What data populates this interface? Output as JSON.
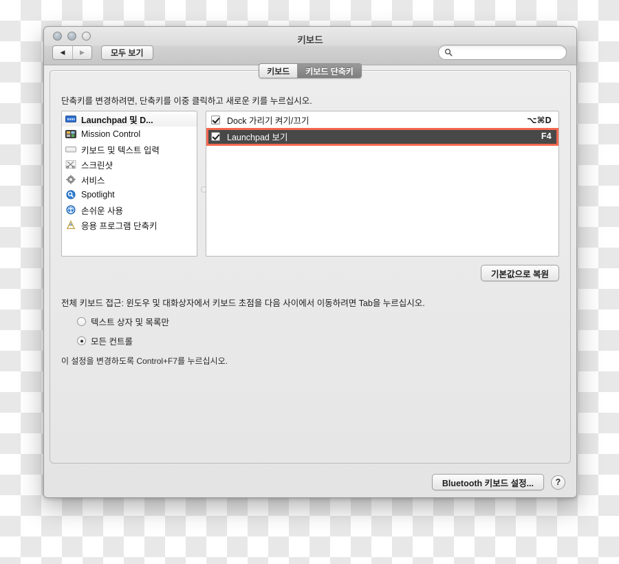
{
  "window": {
    "title": "키보드",
    "traffic_lights": [
      "close-button",
      "minimize-button",
      "zoom-button"
    ]
  },
  "toolbar": {
    "back_label": "◀",
    "forward_label": "▶",
    "show_all_label": "모두 보기",
    "search_value": "",
    "search_placeholder": ""
  },
  "tabs": [
    {
      "label": "키보드",
      "active": false
    },
    {
      "label": "키보드 단축키",
      "active": true
    }
  ],
  "main": {
    "hint": "단축키를 변경하려면, 단축키를 이중 클릭하고 새로운 키를 누르십시오.",
    "categories": [
      {
        "label": "Launchpad 및 D...",
        "icon": "launchpad-dock-icon",
        "selected": true
      },
      {
        "label": "Mission Control",
        "icon": "mission-control-icon",
        "selected": false
      },
      {
        "label": "키보드 및 텍스트 입력",
        "icon": "keyboard-icon",
        "selected": false
      },
      {
        "label": "스크린샷",
        "icon": "screenshot-icon",
        "selected": false
      },
      {
        "label": "서비스",
        "icon": "services-gear-icon",
        "selected": false
      },
      {
        "label": "Spotlight",
        "icon": "spotlight-icon",
        "selected": false
      },
      {
        "label": "손쉬운 사용",
        "icon": "accessibility-icon",
        "selected": false
      },
      {
        "label": "응용 프로그램 단축키",
        "icon": "app-shortcuts-icon",
        "selected": false
      }
    ],
    "shortcuts": [
      {
        "name": "Dock 가리기 켜기/끄기",
        "key": "⌥⌘D",
        "checked": true,
        "selected": false
      },
      {
        "name": "Launchpad 보기",
        "key": "F4",
        "checked": true,
        "selected": true
      }
    ],
    "restore_defaults_label": "기본값으로 복원",
    "annotation_color": "#f4684f"
  },
  "full_keyboard_access": {
    "title": "전체 키보드 접근: 윈도우 및 대화상자에서 키보드 초점을 다음 사이에서 이동하려면 Tab을 누르십시오.",
    "options": [
      {
        "label": "텍스트 상자 및 목록만",
        "selected": false
      },
      {
        "label": "모든 컨트롤",
        "selected": true
      }
    ],
    "note": "이 설정을 변경하도록 Control+F7를 누르십시오."
  },
  "footer": {
    "bluetooth_label": "Bluetooth 키보드 설정...",
    "help_label": "?"
  }
}
